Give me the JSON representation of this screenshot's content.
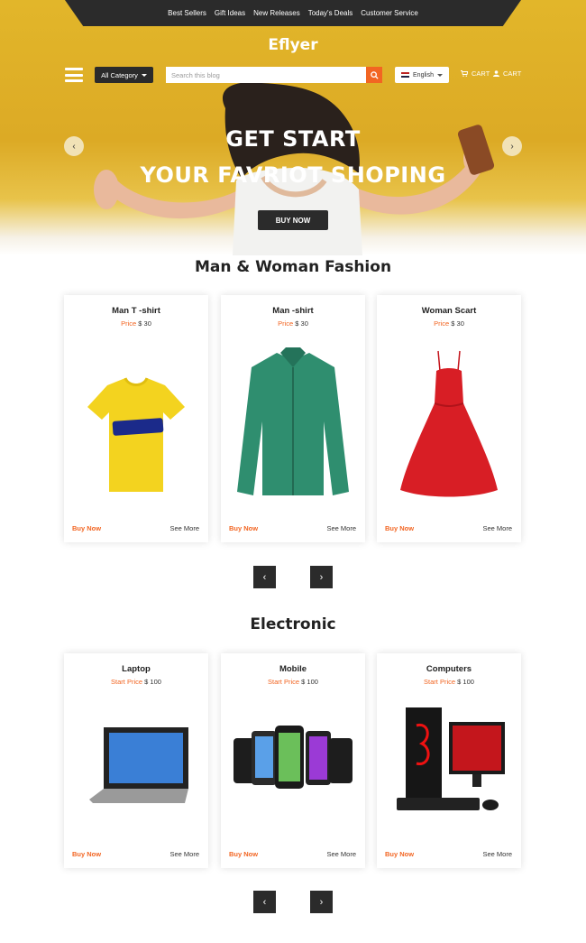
{
  "header": {
    "nav": [
      "Best Sellers",
      "Gift Ideas",
      "New Releases",
      "Today's Deals",
      "Customer Service"
    ],
    "brand": "Eflyer",
    "category_label": "All Category",
    "search_placeholder": "Search this blog",
    "language": "English",
    "cart_label_1": "CART",
    "cart_label_2": "CART"
  },
  "hero": {
    "line1": "GET START",
    "line2": "YOUR FAVRIOT SHOPING",
    "button": "BUY NOW"
  },
  "fashion": {
    "title": "Man & Woman Fashion",
    "products": [
      {
        "name": "Man T -shirt",
        "price_label": "Price",
        "price": "$ 30",
        "buy": "Buy Now",
        "see": "See More",
        "image": "yellow-tshirt"
      },
      {
        "name": "Man -shirt",
        "price_label": "Price",
        "price": "$ 30",
        "buy": "Buy Now",
        "see": "See More",
        "image": "green-shirt"
      },
      {
        "name": "Woman Scart",
        "price_label": "Price",
        "price": "$ 30",
        "buy": "Buy Now",
        "see": "See More",
        "image": "red-dress"
      }
    ]
  },
  "electronic": {
    "title": "Electronic",
    "products": [
      {
        "name": "Laptop",
        "price_label": "Start Price",
        "price": "$ 100",
        "buy": "Buy Now",
        "see": "See More",
        "image": "laptop"
      },
      {
        "name": "Mobile",
        "price_label": "Start Price",
        "price": "$ 100",
        "buy": "Buy Now",
        "see": "See More",
        "image": "phones"
      },
      {
        "name": "Computers",
        "price_label": "Start Price",
        "price": "$ 100",
        "buy": "Buy Now",
        "see": "See More",
        "image": "gaming-pc"
      }
    ]
  },
  "carousel": {
    "prev": "‹",
    "next": "›"
  },
  "colors": {
    "accent": "#f26522",
    "dark": "#2b2b2b",
    "hero": "#dcaa25"
  }
}
